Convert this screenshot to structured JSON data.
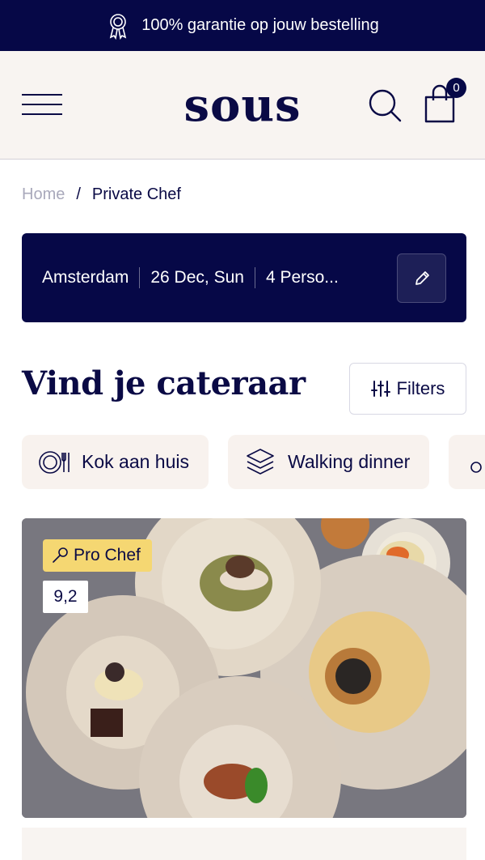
{
  "promo": {
    "text": "100% garantie op jouw bestelling",
    "icon": "award-ribbon-icon"
  },
  "header": {
    "logo": "sous",
    "cart_count": "0"
  },
  "breadcrumb": {
    "home": "Home",
    "separator": "/",
    "current": "Private Chef"
  },
  "search": {
    "location": "Amsterdam",
    "date": "26 Dec, Sun",
    "persons": "4 Perso..."
  },
  "main": {
    "title": "Vind je cateraar",
    "filters_label": "Filters"
  },
  "categories": [
    {
      "label": "Kok aan huis",
      "icon": "plate-cutlery-icon"
    },
    {
      "label": "Walking dinner",
      "icon": "layers-icon"
    }
  ],
  "card": {
    "badge": "Pro Chef",
    "rating": "9,2"
  },
  "colors": {
    "navy": "#060847",
    "cream": "#f8f4f1",
    "badge_yellow": "#f5d772"
  }
}
